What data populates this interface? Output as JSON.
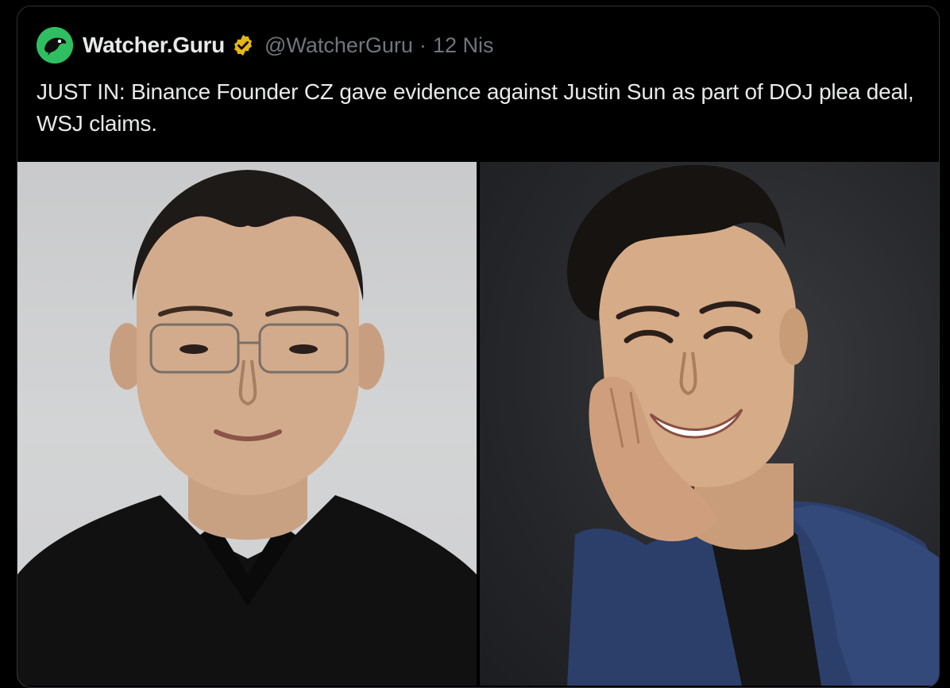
{
  "tweet": {
    "display_name": "Watcher.Guru",
    "handle": "@WatcherGuru",
    "separator": "·",
    "timestamp": "12 Nis",
    "text": "JUST IN: Binance Founder CZ gave evidence against Justin Sun as part of DOJ plea deal, WSJ claims.",
    "verified_icon": "verified-badge-gold",
    "avatar_icon": "watcher-guru-logo"
  },
  "media": {
    "photos": [
      {
        "subject": "portrait-man-glasses-black-shirt"
      },
      {
        "subject": "portrait-man-smiling-blue-blazer"
      }
    ]
  },
  "colors": {
    "background": "#000000",
    "text": "#e7e9ea",
    "muted": "#71767b",
    "avatar": "#2fbf62",
    "verified": "#e2b719"
  }
}
